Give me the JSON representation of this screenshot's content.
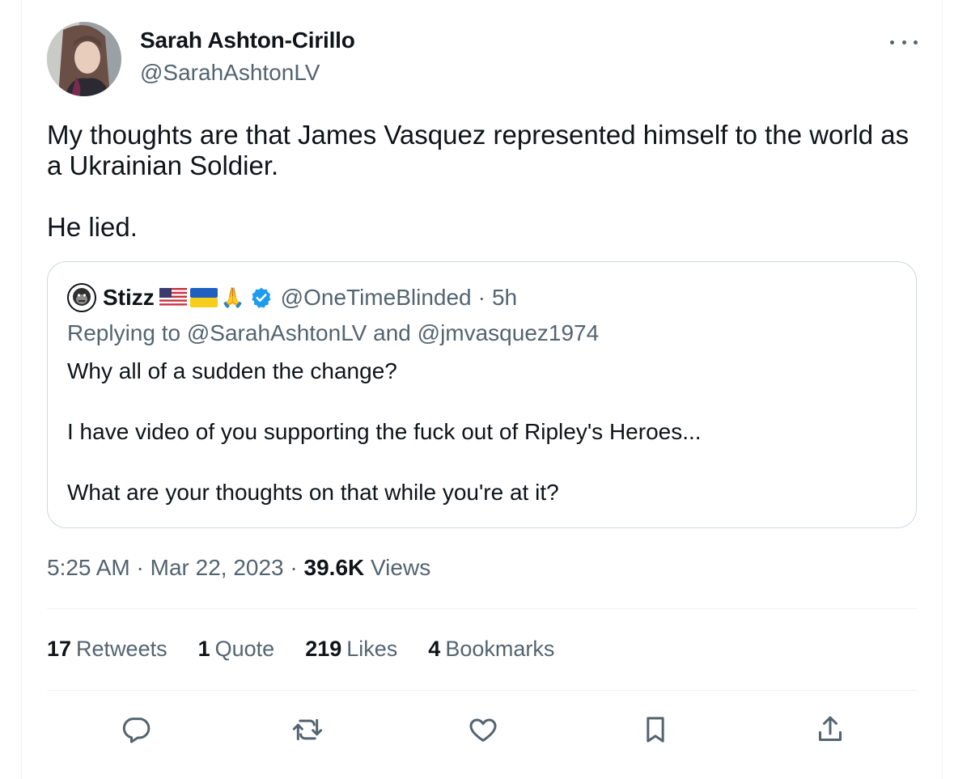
{
  "author": {
    "name": "Sarah Ashton-Cirillo",
    "handle": "@SarahAshtonLV"
  },
  "tweet": {
    "lines": [
      "My thoughts are that James Vasquez represented himself to the world as",
      "a Ukrainian Soldier.",
      "He lied."
    ]
  },
  "quote": {
    "name": "Stizz",
    "handle": "@OneTimeBlinded",
    "sep": "·",
    "time": "5h",
    "replying_prefix": "Replying to",
    "reply_to_1": "@SarahAshtonLV",
    "reply_and": "and",
    "reply_to_2": "@jmvasquez1974",
    "body": [
      "Why all of a sudden the change?",
      "I have video of you supporting the fuck out of Ripley's Heroes...",
      "What are your thoughts on that while you're at it?"
    ]
  },
  "meta": {
    "time": "5:25 AM",
    "sep1": "·",
    "date": "Mar 22, 2023",
    "sep2": "·",
    "views_count": "39.6K",
    "views_label": "Views"
  },
  "stats": {
    "retweets_count": "17",
    "retweets_label": "Retweets",
    "quotes_count": "1",
    "quotes_label": "Quote",
    "likes_count": "219",
    "likes_label": "Likes",
    "bookmarks_count": "4",
    "bookmarks_label": "Bookmarks"
  },
  "icons": {
    "more": "more-icon",
    "reply": "reply-icon",
    "retweet": "retweet-icon",
    "like": "heart-icon",
    "bookmark": "bookmark-icon",
    "share": "share-icon",
    "verified": "verified-badge-icon"
  },
  "colors": {
    "text": "#0f1419",
    "secondary": "#536471",
    "border": "#cfd9de",
    "verified": "#1d9bf0"
  }
}
